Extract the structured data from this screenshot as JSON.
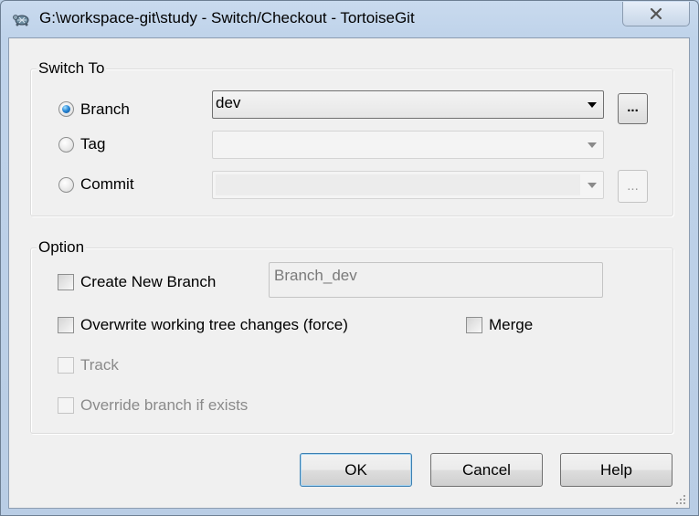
{
  "window": {
    "title": "G:\\workspace-git\\study - Switch/Checkout - TortoiseGit",
    "app_icon": "tortoise-icon",
    "close_icon": "close-icon"
  },
  "switch_to": {
    "group_label": "Switch To",
    "branch": {
      "label": "Branch",
      "selected": true,
      "value": "dev",
      "browse_label": "..."
    },
    "tag": {
      "label": "Tag",
      "selected": false,
      "value": ""
    },
    "commit": {
      "label": "Commit",
      "selected": false,
      "value": "",
      "browse_label": "..."
    }
  },
  "option": {
    "group_label": "Option",
    "create_new_branch": {
      "label": "Create New Branch",
      "checked": false
    },
    "new_branch_name": "Branch_dev",
    "overwrite": {
      "label": "Overwrite working tree changes (force)",
      "checked": false
    },
    "merge": {
      "label": "Merge",
      "checked": false
    },
    "track": {
      "label": "Track",
      "checked": false,
      "enabled": false
    },
    "override_branch": {
      "label": "Override branch if exists",
      "checked": false,
      "enabled": false
    }
  },
  "buttons": {
    "ok": "OK",
    "cancel": "Cancel",
    "help": "Help"
  },
  "colors": {
    "accent_radio": "#2b8ad8",
    "frame": "#bcd0e6",
    "client_bg": "#f0f0f0"
  }
}
